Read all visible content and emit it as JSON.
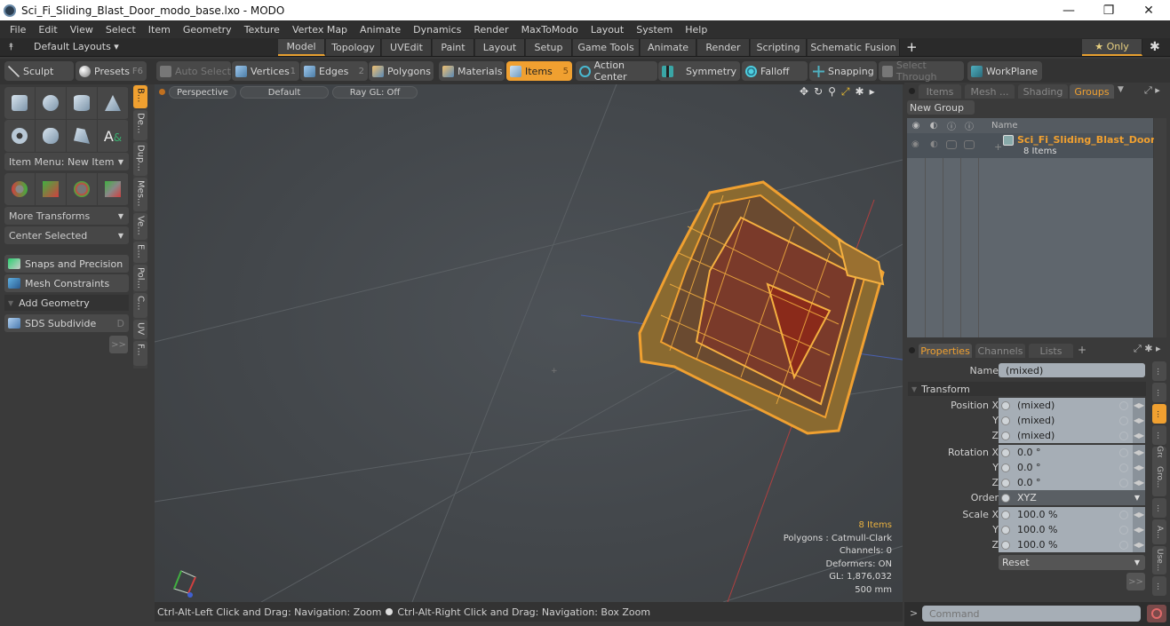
{
  "window": {
    "title": "Sci_Fi_Sliding_Blast_Door_modo_base.lxo - MODO",
    "minimize": "—",
    "restore": "❐",
    "close": "✕"
  },
  "menu": [
    "File",
    "Edit",
    "View",
    "Select",
    "Item",
    "Geometry",
    "Texture",
    "Vertex Map",
    "Animate",
    "Dynamics",
    "Render",
    "MaxToModo",
    "Layout",
    "System",
    "Help"
  ],
  "layouts": {
    "dropdown": "Default Layouts ▾",
    "tabs": [
      "Model",
      "Topology",
      "UVEdit",
      "Paint",
      "Layout",
      "Setup",
      "Game Tools",
      "Animate",
      "Render",
      "Scripting",
      "Schematic Fusion"
    ],
    "active": "Model",
    "add": "+",
    "only": "★ Only",
    "gear": "✱"
  },
  "toolbar": {
    "sculpt": "Sculpt",
    "presets": "Presets",
    "presets_key": "F6",
    "auto_select": "Auto Select",
    "vertices": "Vertices",
    "vertices_key": "1",
    "edges": "Edges",
    "edges_key": "2",
    "polygons": "Polygons",
    "materials": "Materials",
    "items": "Items",
    "items_key": "5",
    "action_center": "Action Center",
    "symmetry": "Symmetry",
    "falloff": "Falloff",
    "snapping": "Snapping",
    "select_through": "Select Through",
    "workplane": "WorkPlane"
  },
  "left_panel": {
    "item_menu": "Item Menu: New Item",
    "more_transforms": "More Transforms",
    "center_selected": "Center Selected",
    "snaps": "Snaps and Precision",
    "mesh_constraints": "Mesh Constraints",
    "add_geometry": "Add Geometry",
    "sds_subdivide": "SDS Subdivide",
    "sds_key": "D",
    "more": ">>",
    "vtabs": [
      "B...",
      "De...",
      "Dup...",
      "Mes...",
      "Ve...",
      "E...",
      "Pol...",
      "C...",
      "UV",
      "F..."
    ]
  },
  "viewport": {
    "view": "Perspective",
    "shading": "Default",
    "raygl": "Ray GL: Off",
    "stats": {
      "items": "8 Items",
      "polygons": "Polygons : Catmull-Clark",
      "channels": "Channels: 0",
      "deformers": "Deformers: ON",
      "gl": "GL: 1,876,032",
      "scale": "500 mm"
    }
  },
  "status": {
    "hint_left": "Ctrl-Alt-Left Click and Drag: Navigation: Zoom",
    "hint_right": "Ctrl-Alt-Right Click and Drag: Navigation: Box Zoom"
  },
  "groups_panel": {
    "tabs": [
      "Items",
      "Mesh ...",
      "Shading",
      "Groups"
    ],
    "active": "Groups",
    "new_group": "New Group",
    "col_name": "Name",
    "group_name": "Sci_Fi_Sliding_Blast_Door...",
    "group_count": "8 Items"
  },
  "properties": {
    "tabs": [
      "Properties",
      "Channels",
      "Lists"
    ],
    "active": "Properties",
    "add": "+",
    "name_label": "Name",
    "name_value": "(mixed)",
    "section": "Transform",
    "rows": [
      {
        "label": "Position X",
        "value": "(mixed)"
      },
      {
        "label": "Y",
        "value": "(mixed)"
      },
      {
        "label": "Z",
        "value": "(mixed)"
      },
      {
        "label": "Rotation X",
        "value": "0.0 °"
      },
      {
        "label": "Y",
        "value": "0.0 °"
      },
      {
        "label": "Z",
        "value": "0.0 °"
      },
      {
        "label": "Order",
        "value": "XYZ"
      },
      {
        "label": "Scale X",
        "value": "100.0 %"
      },
      {
        "label": "Y",
        "value": "100.0 %"
      },
      {
        "label": "Z",
        "value": "100.0 %"
      }
    ],
    "reset": "Reset",
    "more": ">>",
    "vtabs": [
      "...",
      "...",
      "...",
      "...",
      "Gro...",
      "...",
      "A...",
      "Use...",
      "..."
    ]
  },
  "command": {
    "prompt": ">",
    "placeholder": "Command"
  }
}
